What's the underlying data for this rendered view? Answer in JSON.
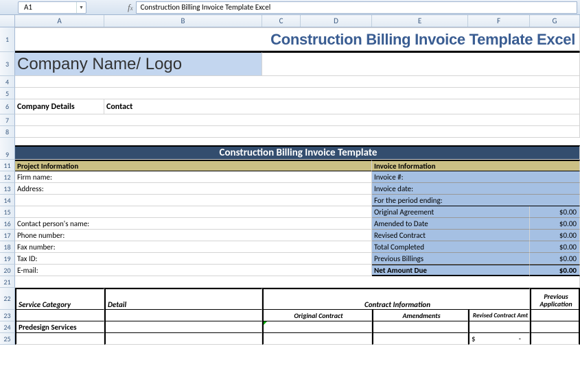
{
  "nameBox": "A1",
  "formulaBar": "Construction Billing Invoice Template Excel",
  "columns": [
    "A",
    "B",
    "C",
    "D",
    "E",
    "F",
    "G"
  ],
  "rows": [
    1,
    3,
    4,
    5,
    6,
    7,
    8,
    9,
    11,
    12,
    13,
    14,
    15,
    16,
    17,
    18,
    19,
    20,
    21,
    22,
    23,
    24,
    25
  ],
  "title": "Construction Billing Invoice Template Excel",
  "company": {
    "nameLogo": "Company Name/ Logo",
    "detailsLabel": "Company Details",
    "contactLabel": "Contact"
  },
  "sectionBar": "Construction Billing Invoice Template",
  "project": {
    "header": "Project Information",
    "firm": "Firm name:",
    "address": "Address:",
    "contactPerson": "Contact person's name:",
    "phone": "Phone number:",
    "fax": "Fax number:",
    "taxId": "Tax ID:",
    "email": "E-mail:"
  },
  "invoice": {
    "header": "Invoice Information",
    "number": "Invoice #:",
    "date": "Invoice date:",
    "periodEnding": "For the period ending:",
    "originalAgreement": {
      "label": "Original Agreement",
      "value": "$0.00"
    },
    "amendedToDate": {
      "label": "Amended to Date",
      "value": "$0.00"
    },
    "revisedContract": {
      "label": "Revised Contract",
      "value": "$0.00"
    },
    "totalCompleted": {
      "label": "Total Completed",
      "value": "$0.00"
    },
    "previousBillings": {
      "label": "Previous Billings",
      "value": "$0.00"
    },
    "netAmountDue": {
      "label": "Net Amount Due",
      "value": "$0.00"
    }
  },
  "table": {
    "serviceCategory": "Service Category",
    "detail": "Detail",
    "contractInfo": "Contract Information",
    "previousApp": "Previous Application",
    "originalContract": "Original Contract",
    "amendments": "Amendments",
    "revisedContractAmt": "Revised Contract Amt",
    "predesign": "Predesign Services",
    "dollar": "$",
    "dash": "-"
  }
}
